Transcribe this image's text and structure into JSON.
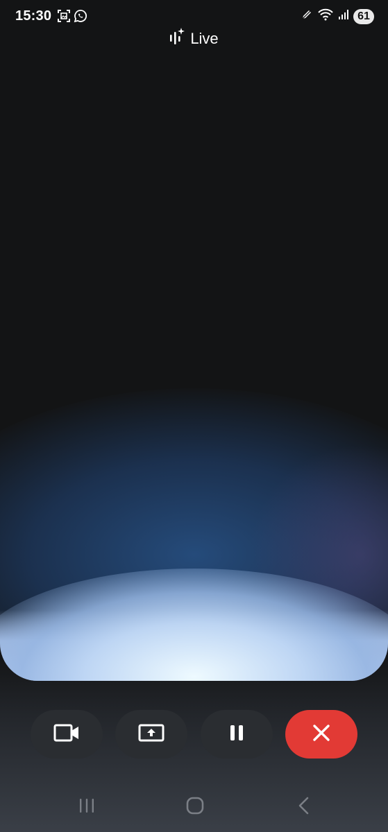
{
  "status_bar": {
    "time": "15:30",
    "battery_level": "61",
    "left_icons": [
      "screenshot-icon",
      "whatsapp-icon"
    ],
    "right_icons": [
      "pen-icon",
      "wifi-icon",
      "signal-icon"
    ]
  },
  "header": {
    "title": "Live",
    "icon": "gemini-live-sparkle-icon"
  },
  "controls": [
    {
      "name": "video-camera-button",
      "icon": "video-camera-icon"
    },
    {
      "name": "screen-share-button",
      "icon": "screen-share-icon"
    },
    {
      "name": "pause-button",
      "icon": "pause-icon"
    },
    {
      "name": "end-call-button",
      "icon": "close-icon"
    }
  ],
  "navigation": [
    "recent-apps-icon",
    "home-icon",
    "back-icon"
  ],
  "colors": {
    "end_button": "#e23a35",
    "control_button": "#2a2d31",
    "background": "#121314"
  }
}
